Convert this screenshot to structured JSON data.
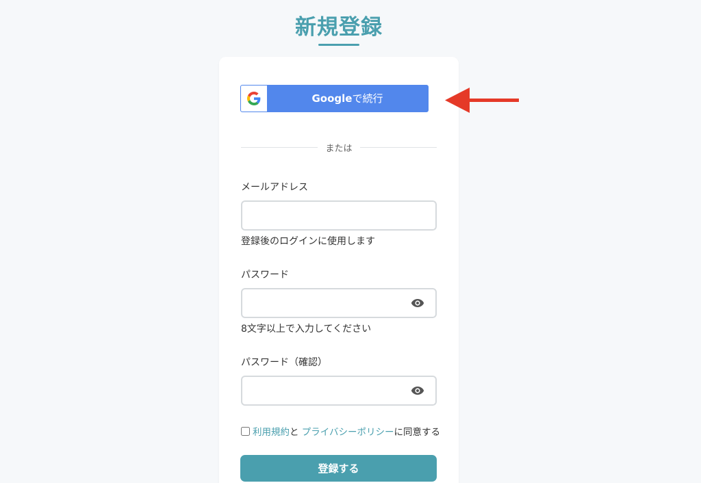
{
  "page": {
    "title": "新規登録"
  },
  "google": {
    "brand": "Google",
    "suffix": "で続行",
    "icon_letter": "G"
  },
  "divider": {
    "text": "または"
  },
  "email": {
    "label": "メールアドレス",
    "value": "",
    "helper": "登録後のログインに使用します"
  },
  "password": {
    "label": "パスワード",
    "value": "",
    "helper": "8文字以上で入力してください",
    "toggle_icon": "eye-icon"
  },
  "password_confirm": {
    "label": "パスワード（確認）",
    "value": "",
    "toggle_icon": "eye-icon"
  },
  "agreement": {
    "checked": false,
    "terms_link": "利用規約",
    "joiner": "と",
    "privacy_link": "プライバシーポリシー",
    "suffix": "に同意する"
  },
  "submit": {
    "label": "登録する"
  },
  "colors": {
    "accent": "#4a9fae",
    "google_blue": "#5287ec",
    "annotation_arrow": "#e53a28",
    "background": "#f6f8fa"
  }
}
